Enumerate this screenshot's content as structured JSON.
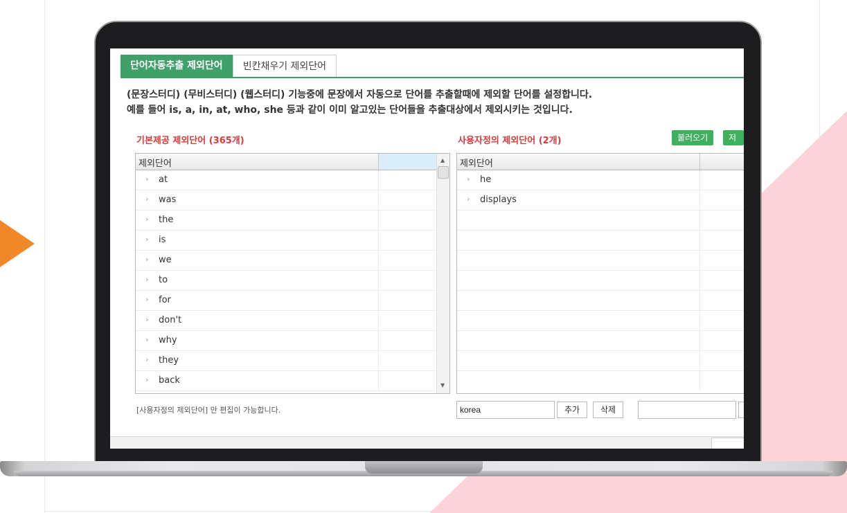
{
  "tabs": [
    "단어자동추출 제외단어",
    "빈칸채우기 제외단어"
  ],
  "description": {
    "line1": "(문장스터디) (무비스터디) (웹스터디) 기능중에 문장에서 자동으로 단어를 추출할때에 제외할 단어를 설정합니다.",
    "line2": "예를 들어 is, a, in, at, who, she 등과 같이 이미 알고있는 단어들을 추출대상에서 제외시키는 것입니다."
  },
  "left_panel": {
    "title": "기본제공 제외단어 (365개)",
    "column_header": "제외단어",
    "words": [
      "at",
      "was",
      "the",
      "is",
      "we",
      "to",
      "for",
      "don't",
      "why",
      "they",
      "back"
    ],
    "note": "[사용자정의 제외단어] 만 편집이 가능합니다."
  },
  "right_panel": {
    "title": "사용자정의 제외단어 (2개)",
    "load_button": "불러오기",
    "save_button": "저장",
    "column_header": "제외단어",
    "words": [
      "he",
      "displays"
    ],
    "input_value": "korea",
    "add_button": "추가",
    "delete_button": "삭제",
    "search_value": ""
  },
  "colors": {
    "accent_green": "#3fa06a",
    "title_red": "#d83b3b",
    "arrow_orange": "#f0882a",
    "pink_bg": "#fbd3d9"
  },
  "icons": {
    "row_chevron": "›",
    "scroll_up": "▲",
    "scroll_down": "▼",
    "arrow": "arrow-right-icon"
  }
}
